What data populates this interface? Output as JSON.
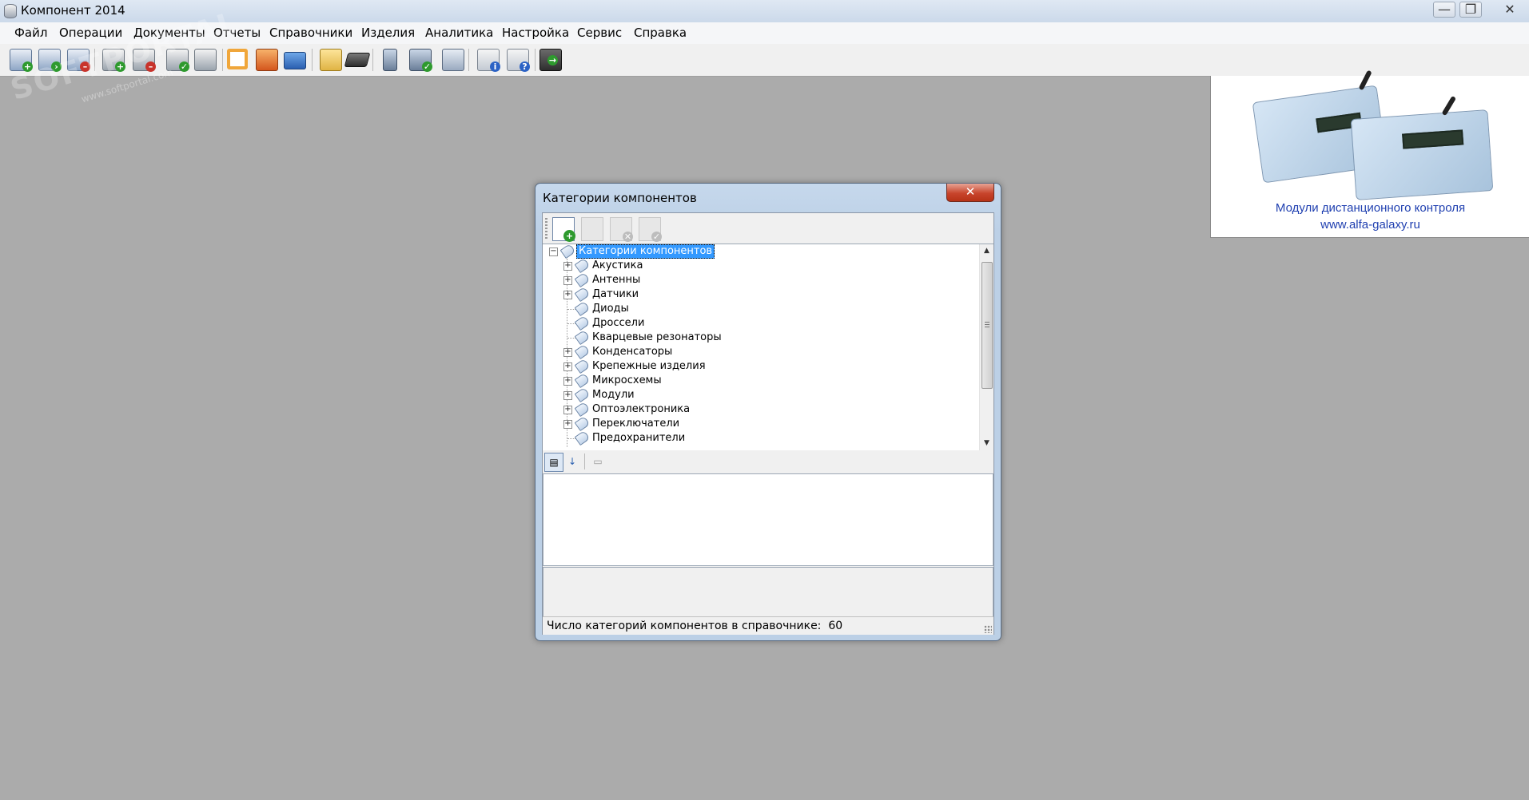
{
  "app": {
    "title": "Компонент 2014"
  },
  "window_controls": {
    "minimize": "—",
    "maximize": "❐",
    "close": "✕"
  },
  "menu": [
    "Файл",
    "Операции",
    "Документы",
    "Отчеты",
    "Справочники",
    "Изделия",
    "Аналитика",
    "Настройка",
    "Сервис",
    "Справка"
  ],
  "toolbar_icons": [
    "calendar-add-icon",
    "calendar-arrow-icon",
    "calendar-remove-icon",
    "stack-add-icon",
    "stack-remove-icon",
    "stack-check-icon",
    "stack-edit-icon",
    "frame-icon",
    "factory-icon",
    "truck-icon",
    "folder-tree-icon",
    "chip-icon",
    "device-icon",
    "device-check-icon",
    "cabinet-icon",
    "info-icon",
    "help-icon",
    "exit-icon"
  ],
  "watermark": {
    "text": "SOFTPORTAL",
    "sub": "www.softportal.com"
  },
  "ad": {
    "line1": "Модули дистанционного контроля",
    "line2": "www.alfa-galaxy.ru"
  },
  "dialog": {
    "title": "Категории компонентов",
    "close_symbol": "✕",
    "toolbar_icons": [
      "add-document-icon",
      "back-icon",
      "delete-icon",
      "accept-icon"
    ],
    "tree": {
      "root": "Категории компонентов",
      "items": [
        {
          "label": "Акустика",
          "expandable": true
        },
        {
          "label": "Антенны",
          "expandable": true
        },
        {
          "label": "Датчики",
          "expandable": true
        },
        {
          "label": "Диоды",
          "expandable": false
        },
        {
          "label": "Дроссели",
          "expandable": false
        },
        {
          "label": "Кварцевые резонаторы",
          "expandable": false
        },
        {
          "label": "Конденсаторы",
          "expandable": true
        },
        {
          "label": "Крепежные изделия",
          "expandable": true
        },
        {
          "label": "Микросхемы",
          "expandable": true
        },
        {
          "label": "Модули",
          "expandable": true
        },
        {
          "label": "Оптоэлектроника",
          "expandable": true
        },
        {
          "label": "Переключатели",
          "expandable": true
        },
        {
          "label": "Предохранители",
          "expandable": false
        }
      ]
    },
    "status_label": "Число категорий компонентов в справочнике:",
    "status_count": "60"
  }
}
